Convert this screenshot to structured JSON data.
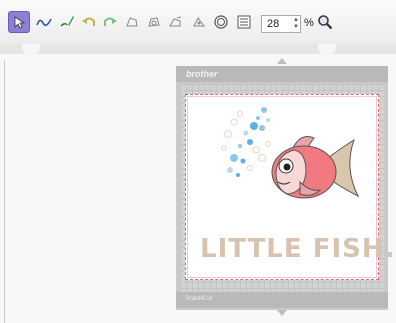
{
  "toolbar": {
    "tools": [
      {
        "name": "select-tool",
        "icon": "pointer-icon",
        "active": true
      },
      {
        "name": "node-tool",
        "icon": "curve-icon"
      },
      {
        "name": "pen-tool",
        "icon": "pen-icon"
      },
      {
        "name": "undo",
        "icon": "undo-icon"
      },
      {
        "name": "redo",
        "icon": "redo-icon"
      },
      {
        "name": "shape-tool-1",
        "icon": "shape-icon"
      },
      {
        "name": "shape-tool-2",
        "icon": "shape-icon"
      },
      {
        "name": "shape-tool-3",
        "icon": "shape-icon"
      },
      {
        "name": "shape-tool-4",
        "icon": "shape-icon"
      },
      {
        "name": "circle-tool",
        "icon": "circle-icon"
      },
      {
        "name": "list-tool",
        "icon": "list-icon"
      }
    ],
    "zoom_value": "28",
    "zoom_unit": "%",
    "accent": "#8c7fd6"
  },
  "mat": {
    "brand": "brother",
    "footer": "ScanNCut"
  },
  "artwork": {
    "title": "LITTLE FISH."
  }
}
